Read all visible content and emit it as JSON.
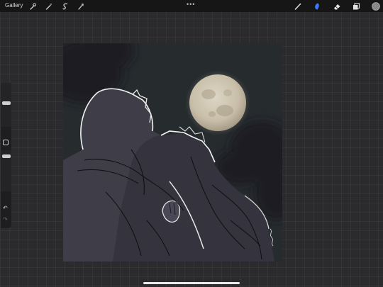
{
  "topbar": {
    "gallery_label": "Gallery",
    "left_tools": [
      "wrench-icon",
      "magic-wand-icon",
      "selection-icon",
      "transform-arrow-icon"
    ],
    "more_label": "•••",
    "right_tools": [
      "brush-icon",
      "smudge-icon",
      "eraser-icon",
      "layers-icon",
      "color-swatch"
    ]
  },
  "sidebar": {
    "brush_size_level": 0.35,
    "opacity_level": 0.45,
    "undo_label": "↶",
    "redo_label": "↷"
  },
  "colors": {
    "accent": "#3a7bfd",
    "active_color": "#8a8a8a"
  }
}
